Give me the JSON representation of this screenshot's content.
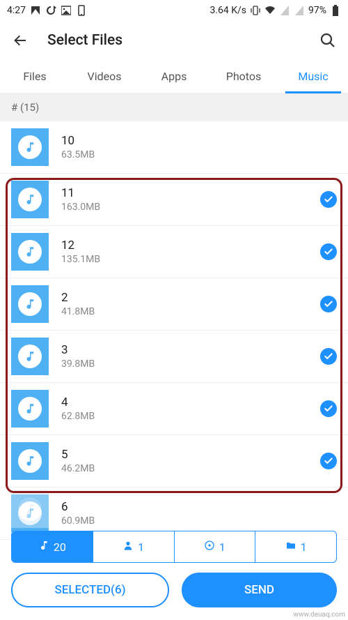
{
  "status": {
    "time": "4:27",
    "speed": "3.64 K/s",
    "battery": "97%"
  },
  "header": {
    "title": "Select Files"
  },
  "tabs": {
    "items": [
      {
        "label": "Files"
      },
      {
        "label": "Videos"
      },
      {
        "label": "Apps"
      },
      {
        "label": "Photos"
      },
      {
        "label": "Music"
      }
    ],
    "active_index": 4
  },
  "section": {
    "label": "# (15)"
  },
  "files": [
    {
      "name": "10",
      "size": "63.5MB",
      "selected": false
    },
    {
      "name": "11",
      "size": "163.0MB",
      "selected": true
    },
    {
      "name": "12",
      "size": "135.1MB",
      "selected": true
    },
    {
      "name": "2",
      "size": "41.8MB",
      "selected": true
    },
    {
      "name": "3",
      "size": "39.8MB",
      "selected": true
    },
    {
      "name": "4",
      "size": "62.8MB",
      "selected": true
    },
    {
      "name": "5",
      "size": "46.2MB",
      "selected": true
    },
    {
      "name": "6",
      "size": "60.9MB",
      "selected": false
    }
  ],
  "filters": {
    "items": [
      {
        "icon": "music",
        "count": "20",
        "active": true
      },
      {
        "icon": "person",
        "count": "1",
        "active": false
      },
      {
        "icon": "disc",
        "count": "1",
        "active": false
      },
      {
        "icon": "folder",
        "count": "1",
        "active": false
      }
    ]
  },
  "buttons": {
    "selected": "SELECTED(6)",
    "send": "SEND"
  },
  "watermark": "www.deuaq.com"
}
